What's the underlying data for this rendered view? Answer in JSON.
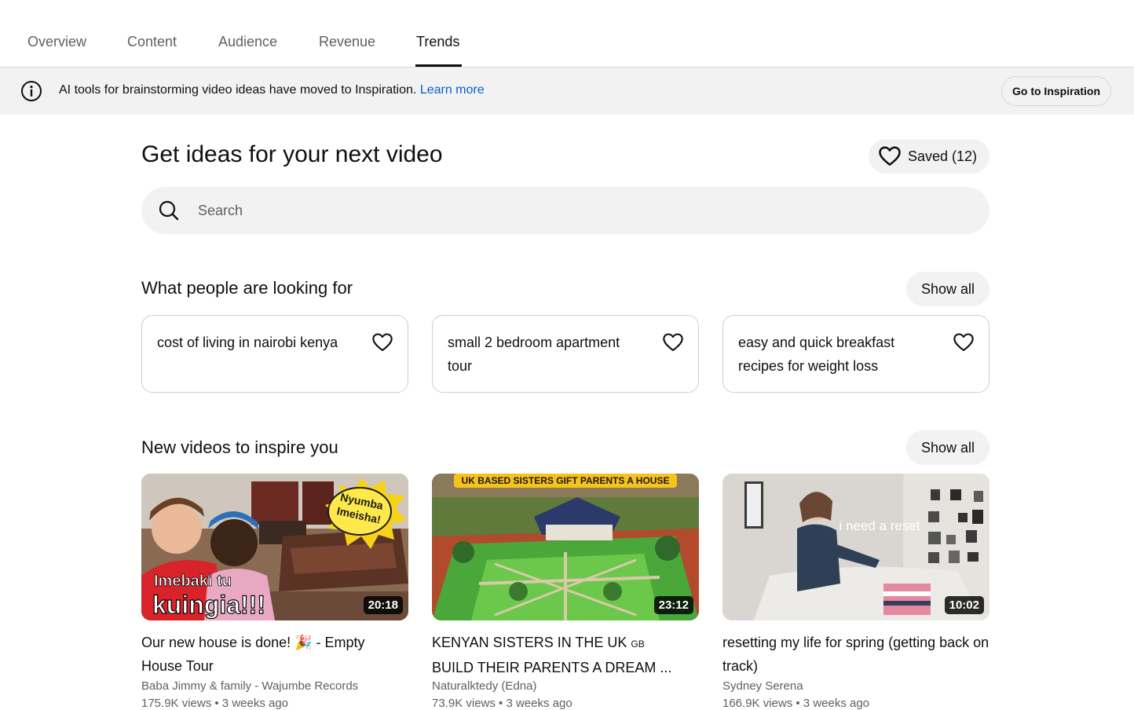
{
  "tabs": [
    {
      "label": "Overview"
    },
    {
      "label": "Content"
    },
    {
      "label": "Audience"
    },
    {
      "label": "Revenue"
    },
    {
      "label": "Trends",
      "active": true
    }
  ],
  "banner": {
    "icon": "info-icon",
    "text": "AI tools for brainstorming video ideas have moved to Inspiration.",
    "link": "Learn more",
    "button": "Go to Inspiration"
  },
  "page": {
    "title": "Get ideas for your next video",
    "saved_label": "Saved (12)"
  },
  "search": {
    "placeholder": "Search",
    "value": ""
  },
  "looking_for": {
    "title": "What people are looking for",
    "show_all": "Show all",
    "ideas": [
      {
        "text": "cost of living in nairobi kenya"
      },
      {
        "text": "small 2 bedroom apartment tour"
      },
      {
        "text": "easy and quick breakfast recipes for weight loss"
      }
    ]
  },
  "new_videos": {
    "title": "New videos to inspire you",
    "show_all": "Show all",
    "videos": [
      {
        "title": "Our new house is done! 🎉 - Empty House Tour",
        "channel": "Baba Jimmy & family - Wajumbe Records",
        "stats": "175.9K views • 3 weeks ago",
        "duration": "20:18",
        "thumb_caption_1": "Imebaki tu",
        "thumb_caption_2": "kuingia!!!",
        "thumb_badge_1": "Nyumba",
        "thumb_badge_2": "Imeisha!"
      },
      {
        "title": "KENYAN SISTERS IN THE UK",
        "title_flag": "GB",
        "title_rest": "BUILD THEIR PARENTS A DREAM ...",
        "channel": "Naturalktedy (Edna)",
        "stats": "73.9K views • 3 weeks ago",
        "duration": "23:12",
        "thumb_banner": "UK BASED SISTERS GIFT PARENTS A HOUSE"
      },
      {
        "title": "resetting my life for spring (getting back on track)",
        "channel": "Sydney Serena",
        "stats": "166.9K views • 3 weeks ago",
        "duration": "10:02",
        "thumb_caption": "i need a reset"
      }
    ]
  },
  "colors": {
    "link": "#065fd4",
    "chip_bg": "#f2f2f2",
    "text_secondary": "#606060"
  }
}
